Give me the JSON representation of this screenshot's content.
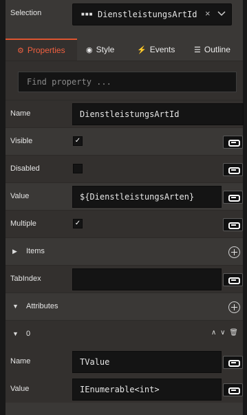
{
  "selection": {
    "label": "Selection",
    "value": "DienstleistungsArtId",
    "icon": "grid-icon",
    "clear": "×"
  },
  "tabs": [
    {
      "label": "Properties",
      "icon": "⚙",
      "active": true
    },
    {
      "label": "Style",
      "icon": "◉",
      "active": false
    },
    {
      "label": "Events",
      "icon": "⚡",
      "active": false
    },
    {
      "label": "Outline",
      "icon": "☰",
      "active": false
    }
  ],
  "search": {
    "placeholder": "Find property ..."
  },
  "props": {
    "name": {
      "label": "Name",
      "value": "DienstleistungsArtId"
    },
    "visible": {
      "label": "Visible",
      "checked": true,
      "check": "✓"
    },
    "disabled": {
      "label": "Disabled",
      "checked": false,
      "check": ""
    },
    "value": {
      "label": "Value",
      "value": "${DienstleistungsArten}"
    },
    "multiple": {
      "label": "Multiple",
      "checked": true,
      "check": "✓"
    },
    "items": {
      "label": "Items",
      "expander": "▶"
    },
    "tabindex": {
      "label": "TabIndex",
      "value": ""
    },
    "attributes": {
      "label": "Attributes",
      "expander": "▼"
    }
  },
  "attribute_item": {
    "index": "0",
    "expander": "▼",
    "up": "∧",
    "down": "∨",
    "delete": "🗑",
    "name": {
      "label": "Name",
      "value": "TValue"
    },
    "value": {
      "label": "Value",
      "value": "IEnumerable<int>"
    }
  },
  "colors": {
    "accent": "#f06040",
    "panel": "#3a3836",
    "field": "#141414"
  }
}
